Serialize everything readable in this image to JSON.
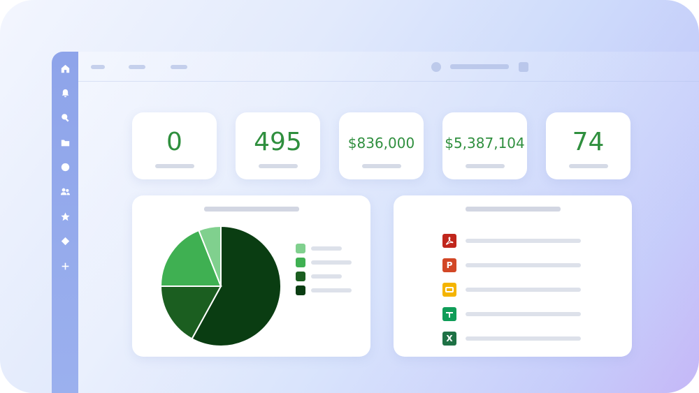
{
  "stats": [
    {
      "value": "0"
    },
    {
      "value": "495"
    },
    {
      "value": "$836,000"
    },
    {
      "value": "$5,387,104"
    },
    {
      "value": "74"
    }
  ],
  "colors": {
    "accent_green": "#2f8f3e",
    "sidebar": "#8ea4ea"
  },
  "sidebar_icons": [
    "home-icon",
    "bell-icon",
    "search-icon",
    "folder-icon",
    "clock-icon",
    "people-icon",
    "star-icon",
    "diamond-icon",
    "plus-icon"
  ],
  "chart_data": {
    "type": "pie",
    "slices": [
      {
        "value": 58,
        "color": "#0a3d12"
      },
      {
        "value": 17,
        "color": "#1b5e20"
      },
      {
        "value": 19,
        "color": "#3fb052"
      },
      {
        "value": 6,
        "color": "#80d08e"
      }
    ],
    "legend_colors": [
      "#80d08e",
      "#3fb052",
      "#1b5e20",
      "#0a3d12"
    ]
  },
  "file_list": [
    {
      "icon": "pdf-icon",
      "glyph": "",
      "color": "#c0261c"
    },
    {
      "icon": "powerpoint-icon",
      "glyph": "P",
      "color": "#d24726"
    },
    {
      "icon": "slides-icon",
      "glyph": "",
      "color": "#f4b400"
    },
    {
      "icon": "sheets-icon",
      "glyph": "",
      "color": "#0f9d58"
    },
    {
      "icon": "excel-icon",
      "glyph": "X",
      "color": "#1e7145"
    }
  ]
}
